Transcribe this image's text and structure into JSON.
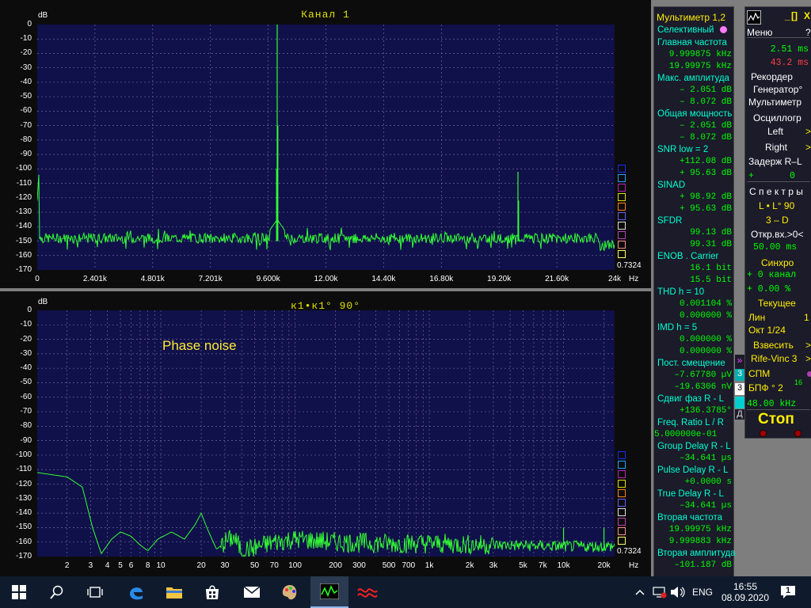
{
  "top_panel": {
    "title": "Канал 1",
    "db_label": "dB",
    "scale_label": "0.7324",
    "hz_label": "Hz",
    "y_ticks": [
      "0",
      "-10",
      "-20",
      "-30",
      "-40",
      "-50",
      "-60",
      "-70",
      "-80",
      "-90",
      "-100",
      "-110",
      "-120",
      "-130",
      "-140",
      "-150",
      "-160",
      "-170"
    ],
    "x_ticks": [
      "0",
      "2.401k",
      "4.801k",
      "7.201k",
      "9.600k",
      "12.00k",
      "14.40k",
      "16.80k",
      "19.20k",
      "21.60k",
      "24k"
    ]
  },
  "bottom_panel": {
    "title": "к1•к1° 90°",
    "db_label": "dB",
    "scale_label": "0.7324",
    "hz_label": "Hz",
    "annotation": "Phase noise",
    "y_ticks": [
      "0",
      "-10",
      "-20",
      "-30",
      "-40",
      "-50",
      "-60",
      "-70",
      "-80",
      "-90",
      "-100",
      "-110",
      "-120",
      "-130",
      "-140",
      "-150",
      "-160",
      "-170"
    ],
    "x_ticks": [
      "2",
      "3",
      "4",
      "5",
      "6",
      "8",
      "10",
      "20",
      "30",
      "50",
      "70",
      "100",
      "200",
      "300",
      "500",
      "700",
      "1k",
      "2k",
      "3k",
      "5k",
      "7k",
      "10k",
      "20k"
    ]
  },
  "meter": {
    "title": "Мультиметр 1,2",
    "selective": "Селективный",
    "main_freq": "Главная частота",
    "main_freq_v1": "9.999875 kHz",
    "main_freq_v2": "19.99975 kHz",
    "max_amp": "Макс. амплитуда",
    "max_amp_v1": "–   2.051 dB",
    "max_amp_v2": "–   8.072 dB",
    "total_power": "Общая мощность",
    "total_power_v1": "–   2.051 dB",
    "total_power_v2": "–   8.072 dB",
    "snr": "SNR     low =  2",
    "snr_v1": "+112.08 dB",
    "snr_v2": "+  95.63 dB",
    "sinad": "SINAD",
    "sinad_v1": "+  98.92 dB",
    "sinad_v2": "+  95.63 dB",
    "sfdr": "SFDR",
    "sfdr_v1": "99.13 dB",
    "sfdr_v2": "99.31 dB",
    "enob": "ENOB . Carrier",
    "enob_v1": "16.1 bit",
    "enob_v2": "15.5 bit",
    "thd": "THD       h = 10",
    "thd_v1": "0.001104 %",
    "thd_v2": "0.000000 %",
    "imd": "IMD        h =  5",
    "imd_v1": "0.000000 %",
    "imd_v2": "0.000000 %",
    "dc": "Пост. смещение",
    "dc_v1": "–7.67780 µV",
    "dc_v2": "–19.6306 nV",
    "phase": "Сдвиг фаз R - L",
    "phase_v1": "+136.3785°",
    "freq_ratio": "Freq. Ratio  L / R",
    "freq_ratio_v1": "5.000000e-01",
    "group_delay": "Group Delay R - L",
    "group_delay_v1": "–34.641 µs",
    "pulse_delay": "Pulse Delay R - L",
    "pulse_delay_v1": "+0.0000  s",
    "true_delay": "True Delay R - L",
    "true_delay_v1": "–34.641 µs",
    "second_freq": "Вторая частота",
    "second_freq_v1": "19.99975 kHz",
    "second_freq_v2": "9.999883 kHz",
    "second_amp": "Вторая амплитуда",
    "second_amp_v1": "–101.187 dB"
  },
  "control": {
    "min_btn": "_",
    "max_btn": "[]",
    "close_btn": "X",
    "menu": "Меню",
    "help": "?",
    "time1": "2.51 ms",
    "time2": "43.2 ms",
    "recorder": "Рекордер",
    "generator": "Генератор°",
    "multimeter": "Мультиметр",
    "oscillograph": "Осциллогр",
    "left": "Left",
    "right": "Right",
    "delay": "Задерж  R–L",
    "delay_sign": "+",
    "delay_val": "0",
    "spectra": "С п е к т р ы",
    "l_l90": "L • L° 90",
    "three_d": "3 – D",
    "open_in": "Откр.вх.>0<",
    "open_time": "50.00 ms",
    "sync": "Синхро",
    "sync_channel": "+  0 канал",
    "sync_pct": "+  0.00 %",
    "current": "Текущее",
    "lin": "Лин",
    "lin_val": "1",
    "oct": "Окт  1/24",
    "weigh": "Взвесить",
    "rife": "Rife-Vinc 3",
    "spm": "СПМ",
    "fft": "БПФ ° 2",
    "fft_exp": "16",
    "rate": "48.00 kHz",
    "stop": "Стоп",
    "strip1": "3",
    "strip2": "3",
    "strip3": "Д"
  },
  "taskbar": {
    "lang": "ENG",
    "time": "16:55",
    "date": "08.09.2020",
    "notif_count": "1"
  }
}
